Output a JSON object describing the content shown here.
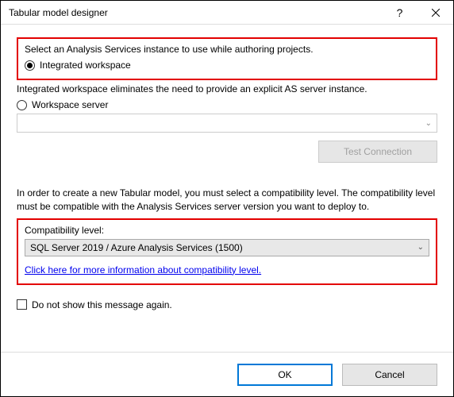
{
  "window": {
    "title": "Tabular model designer"
  },
  "section1": {
    "instruction": "Select an Analysis Services instance to use while authoring projects.",
    "radio_integrated": "Integrated workspace",
    "integrated_desc": "Integrated workspace eliminates the need to provide an explicit AS server instance.",
    "radio_workspace": "Workspace server",
    "test_connection": "Test Connection"
  },
  "section2": {
    "desc": "In order to create a new Tabular model, you must select a compatibility level. The compatibility level must be compatible with the Analysis Services server version you want to deploy to.",
    "label": "Compatibility level:",
    "selected": "SQL Server 2019 / Azure Analysis Services (1500)",
    "link": "Click here for more information about compatibility level."
  },
  "checkbox": {
    "label": "Do not show this message again."
  },
  "buttons": {
    "ok": "OK",
    "cancel": "Cancel"
  }
}
